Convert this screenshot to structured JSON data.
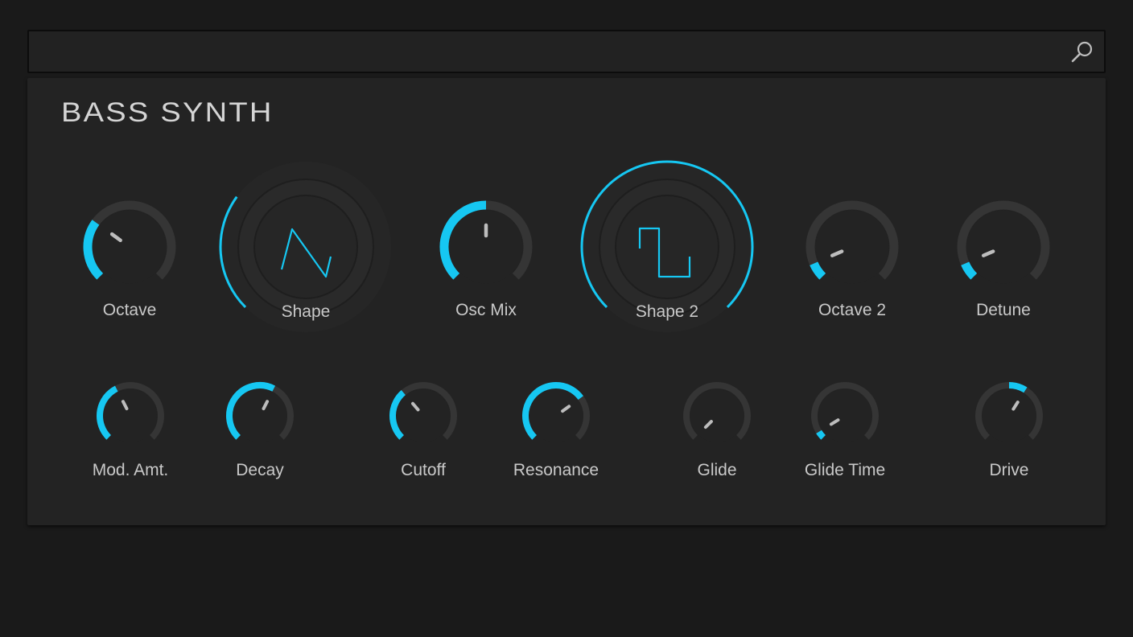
{
  "search": {
    "placeholder": "",
    "value": ""
  },
  "panel": {
    "title": "BASS SYNTH"
  },
  "colors": {
    "accent": "#16c7f2",
    "track": "#353535",
    "knob_face": "#232323",
    "label": "#c9c9c9"
  },
  "icons": {
    "search": "search-icon"
  },
  "knobs": [
    {
      "id": "octave",
      "label": "Octave",
      "level": 0.3,
      "style": "small"
    },
    {
      "id": "shape",
      "label": "Shape",
      "level": 0.3,
      "style": "large",
      "waveform": "sawtooth"
    },
    {
      "id": "osc-mix",
      "label": "Osc Mix",
      "level": 0.5,
      "style": "small"
    },
    {
      "id": "shape-2",
      "label": "Shape 2",
      "level": 1.0,
      "style": "large",
      "waveform": "square"
    },
    {
      "id": "octave-2",
      "label": "Octave 2",
      "level": 0.08,
      "style": "small"
    },
    {
      "id": "detune",
      "label": "Detune",
      "level": 0.08,
      "style": "small"
    },
    {
      "id": "mod-amt",
      "label": "Mod. Amt.",
      "level": 0.4,
      "style": "small"
    },
    {
      "id": "decay",
      "label": "Decay",
      "level": 0.6,
      "style": "small"
    },
    {
      "id": "cutoff",
      "label": "Cutoff",
      "level": 0.35,
      "style": "small"
    },
    {
      "id": "resonance",
      "label": "Resonance",
      "level": 0.7,
      "style": "small"
    },
    {
      "id": "glide",
      "label": "Glide",
      "level": 0.0,
      "style": "small"
    },
    {
      "id": "glide-time",
      "label": "Glide Time",
      "level": 0.05,
      "style": "small"
    },
    {
      "id": "drive",
      "label": "Drive",
      "level": 0.62,
      "style": "small",
      "arc_start": 0.5
    }
  ]
}
